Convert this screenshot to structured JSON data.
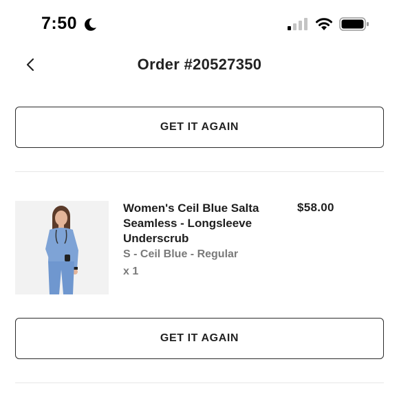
{
  "status_bar": {
    "time": "7:50",
    "icons": [
      "moon-icon",
      "signal-icon",
      "wifi-icon",
      "battery-icon"
    ]
  },
  "header": {
    "title": "Order #20527350",
    "back_icon": "chevron-left-icon"
  },
  "actions": {
    "get_it_again_top": "GET IT AGAIN",
    "get_it_again_bottom": "GET IT AGAIN"
  },
  "product": {
    "name": "Women's Ceil Blue Salta Seamless - Longsleeve Underscrub",
    "price": "$58.00",
    "variant": "S - Ceil Blue - Regular",
    "quantity": "x 1",
    "image_color": "#7ea3d6"
  },
  "colors": {
    "text_primary": "#1e1e1e",
    "text_secondary": "#7a7a7a",
    "button_border": "#2a2a2a",
    "divider": "#e6e6e6"
  }
}
